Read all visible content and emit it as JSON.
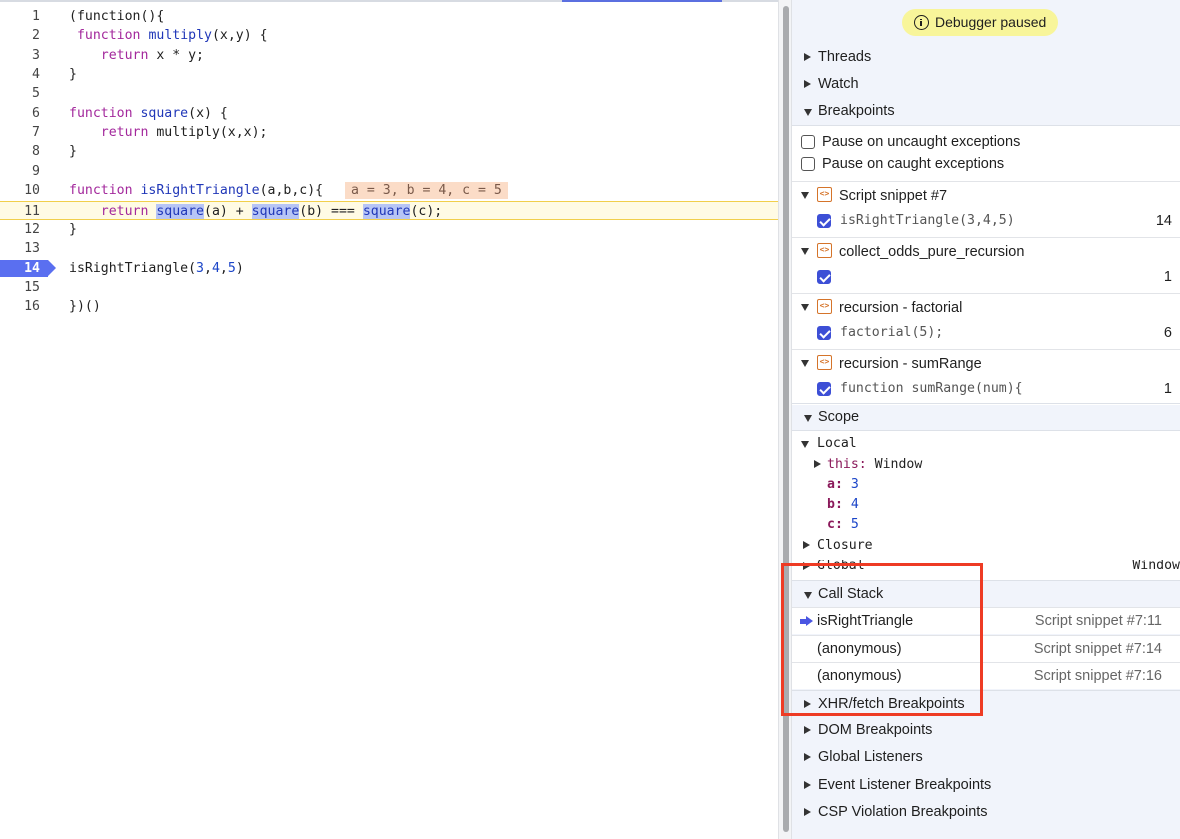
{
  "editor": {
    "lines": [
      {
        "num": "1",
        "parts": [
          [
            "p",
            "(function(){"
          ]
        ]
      },
      {
        "num": "2",
        "parts": [
          [
            "p",
            " "
          ],
          [
            "kw",
            "function"
          ],
          [
            "p",
            " "
          ],
          [
            "fn",
            "multiply"
          ],
          [
            "p",
            "(x,y) {"
          ]
        ]
      },
      {
        "num": "3",
        "parts": [
          [
            "p",
            "    "
          ],
          [
            "kw",
            "return"
          ],
          [
            "p",
            " x * y;"
          ]
        ]
      },
      {
        "num": "4",
        "parts": [
          [
            "p",
            "}"
          ]
        ]
      },
      {
        "num": "5",
        "parts": []
      },
      {
        "num": "6",
        "parts": [
          [
            "kw",
            "function"
          ],
          [
            "p",
            " "
          ],
          [
            "fn",
            "square"
          ],
          [
            "p",
            "(x) {"
          ]
        ]
      },
      {
        "num": "7",
        "parts": [
          [
            "p",
            "    "
          ],
          [
            "kw",
            "return"
          ],
          [
            "p",
            " multiply(x,x);"
          ]
        ]
      },
      {
        "num": "8",
        "parts": [
          [
            "p",
            "}"
          ]
        ]
      },
      {
        "num": "9",
        "parts": []
      },
      {
        "num": "10",
        "parts": [
          [
            "kw",
            "function"
          ],
          [
            "p",
            " "
          ],
          [
            "fn",
            "isRightTriangle"
          ],
          [
            "p",
            "(a,b,c){"
          ]
        ]
      },
      {
        "num": "11",
        "parts": [
          [
            "p",
            "    "
          ],
          [
            "kw",
            "return"
          ],
          [
            "p",
            " "
          ],
          [
            "hl",
            "square"
          ],
          [
            "p",
            "(a) + "
          ],
          [
            "hl",
            "square"
          ],
          [
            "p",
            "(b) === "
          ],
          [
            "hl",
            "square"
          ],
          [
            "p",
            "(c);"
          ]
        ]
      },
      {
        "num": "12",
        "parts": [
          [
            "p",
            "}"
          ]
        ]
      },
      {
        "num": "13",
        "parts": []
      },
      {
        "num": "14",
        "parts": [
          [
            "p",
            "isRightTriangle("
          ],
          [
            "num",
            "3"
          ],
          [
            "p",
            ","
          ],
          [
            "num",
            "4"
          ],
          [
            "p",
            ","
          ],
          [
            "num",
            "5"
          ],
          [
            "p",
            ")"
          ]
        ]
      },
      {
        "num": "15",
        "parts": []
      },
      {
        "num": "16",
        "parts": [
          [
            "p",
            "})()"
          ]
        ]
      }
    ],
    "inline_values": "a = 3, b = 4, c = 5",
    "breakpoint_line": "14",
    "current_line": "11"
  },
  "sidebar": {
    "paused_label": "Debugger paused",
    "threads_label": "Threads",
    "watch_label": "Watch",
    "breakpoints_label": "Breakpoints",
    "pause_uncaught": "Pause on uncaught exceptions",
    "pause_caught": "Pause on caught exceptions",
    "breakpoint_files": [
      {
        "name": "Script snippet #7",
        "code": "isRightTriangle(3,4,5)",
        "line": "14"
      },
      {
        "name": "collect_odds_pure_recursion",
        "code": "",
        "line": "1"
      },
      {
        "name": "recursion - factorial",
        "code": "factorial(5);",
        "line": "6"
      },
      {
        "name": "recursion - sumRange",
        "code": "function sumRange(num){",
        "line": "1"
      }
    ],
    "scope_label": "Scope",
    "scope": {
      "local_label": "Local",
      "this_name": "this",
      "this_value": "Window",
      "vars": [
        {
          "name": "a",
          "value": "3"
        },
        {
          "name": "b",
          "value": "4"
        },
        {
          "name": "c",
          "value": "5"
        }
      ],
      "closure_label": "Closure",
      "global_label": "Global",
      "global_value": "Window"
    },
    "call_stack_label": "Call Stack",
    "call_stack": [
      {
        "fn": "isRightTriangle",
        "loc": "Script snippet #7:11"
      },
      {
        "fn": "(anonymous)",
        "loc": "Script snippet #7:14"
      },
      {
        "fn": "(anonymous)",
        "loc": "Script snippet #7:16"
      }
    ],
    "more_sections": [
      "XHR/fetch Breakpoints",
      "DOM Breakpoints",
      "Global Listeners",
      "Event Listener Breakpoints",
      "CSP Violation Breakpoints"
    ]
  },
  "colors": {
    "accent": "#3d4fd6",
    "annotation_box": "#ee3b24",
    "paused_banner": "#f8f59a"
  }
}
